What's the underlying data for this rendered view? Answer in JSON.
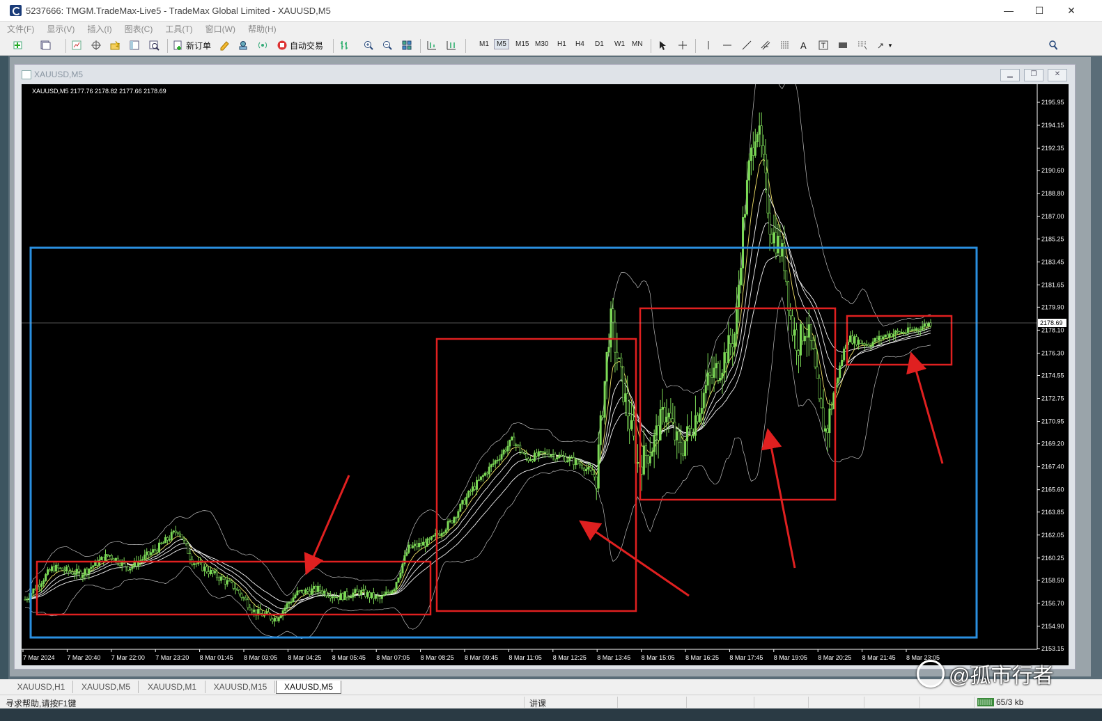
{
  "window": {
    "title": "5237666: TMGM.TradeMax-Live5 - TradeMax Global Limited - XAUUSD,M5",
    "minimize": "—",
    "maximize": "☐",
    "close": "✕"
  },
  "menu": [
    "文件(F)",
    "显示(V)",
    "插入(I)",
    "图表(C)",
    "工具(T)",
    "窗口(W)",
    "帮助(H)"
  ],
  "toolbar": {
    "new_order": "新订单",
    "auto_trading": "自动交易",
    "timeframes": [
      "M1",
      "M5",
      "M15",
      "M30",
      "H1",
      "H4",
      "D1",
      "W1",
      "MN"
    ],
    "active_timeframe": "M5",
    "text_tool": "A",
    "notification_count": "1"
  },
  "chart_window": {
    "title": "XAUUSD,M5"
  },
  "chart_data": {
    "type": "candlestick",
    "header": "XAUUSD,M5  2177.76 2178.82 2177.66 2178.69",
    "symbol": "XAUUSD,M5",
    "ohlc": {
      "open": 2177.76,
      "high": 2178.82,
      "low": 2177.66,
      "close": 2178.69
    },
    "current_price": "2178.69",
    "ylim": [
      2153.15,
      2197.6
    ],
    "y_ticks": [
      "2195.95",
      "2194.15",
      "2192.35",
      "2190.60",
      "2188.80",
      "2187.00",
      "2185.25",
      "2183.45",
      "2181.65",
      "2179.90",
      "2178.10",
      "2176.30",
      "2174.55",
      "2172.75",
      "2170.95",
      "2169.20",
      "2167.40",
      "2165.60",
      "2163.85",
      "2162.05",
      "2160.25",
      "2158.50",
      "2156.70",
      "2154.90",
      "2153.15"
    ],
    "x_ticks": [
      "7 Mar 2024",
      "7 Mar 20:40",
      "7 Mar 22:00",
      "7 Mar 23:20",
      "8 Mar 01:45",
      "8 Mar 03:05",
      "8 Mar 04:25",
      "8 Mar 05:45",
      "8 Mar 07:05",
      "8 Mar 08:25",
      "8 Mar 09:45",
      "8 Mar 11:05",
      "8 Mar 12:25",
      "8 Mar 13:45",
      "8 Mar 15:05",
      "8 Mar 16:25",
      "8 Mar 17:45",
      "8 Mar 19:05",
      "8 Mar 20:25",
      "8 Mar 21:45",
      "8 Mar 23:05"
    ],
    "series": [
      {
        "values": [
          [
            0,
            2157.0
          ],
          [
            4,
            2159.5
          ],
          [
            8,
            2159.0
          ],
          [
            12,
            2160.5
          ],
          [
            15,
            2159.5
          ],
          [
            19,
            2161.0
          ],
          [
            22,
            2162.5
          ],
          [
            24,
            2160.0
          ],
          [
            27,
            2159.0
          ],
          [
            30,
            2158.0
          ],
          [
            33,
            2156.0
          ],
          [
            36,
            2155.5
          ],
          [
            39,
            2157.5
          ],
          [
            42,
            2157.8
          ],
          [
            45,
            2157.2
          ],
          [
            48,
            2157.6
          ],
          [
            51,
            2157.0
          ],
          [
            53,
            2158.0
          ],
          [
            55,
            2161.0
          ],
          [
            58,
            2161.5
          ],
          [
            61,
            2163.0
          ],
          [
            64,
            2165.5
          ],
          [
            67,
            2167.5
          ],
          [
            70,
            2169.5
          ],
          [
            72,
            2168.0
          ],
          [
            75,
            2168.5
          ],
          [
            78,
            2168.0
          ],
          [
            80,
            2167.5
          ],
          [
            82,
            2166.5
          ],
          [
            84,
            2179.0
          ],
          [
            86,
            2173.0
          ],
          [
            88,
            2167.5
          ],
          [
            90,
            2169.0
          ],
          [
            92,
            2172.0
          ],
          [
            94,
            2168.5
          ],
          [
            96,
            2171.0
          ],
          [
            98,
            2174.0
          ],
          [
            100,
            2175.5
          ],
          [
            102,
            2178.0
          ],
          [
            103,
            2186.0
          ],
          [
            104,
            2191.0
          ],
          [
            105,
            2194.5
          ],
          [
            106,
            2191.0
          ],
          [
            107,
            2186.0
          ],
          [
            108,
            2185.0
          ],
          [
            109,
            2183.5
          ],
          [
            110,
            2178.5
          ],
          [
            111,
            2177.0
          ],
          [
            112,
            2178.5
          ],
          [
            113,
            2176.5
          ],
          [
            114,
            2172.0
          ],
          [
            115,
            2170.0
          ],
          [
            116,
            2173.0
          ],
          [
            118,
            2177.5
          ],
          [
            121,
            2177.0
          ],
          [
            124,
            2177.8
          ],
          [
            127,
            2178.0
          ],
          [
            130,
            2178.69
          ]
        ]
      }
    ],
    "annotation_boxes": [
      {
        "color": "#e02020",
        "label": ""
      },
      {
        "color": "#e02020",
        "label": ""
      },
      {
        "color": "#e02020",
        "label": ""
      },
      {
        "color": "#e02020",
        "label": ""
      },
      {
        "color": "#2a8fe0",
        "label": ""
      }
    ]
  },
  "tabs": [
    {
      "label": "XAUUSD,H1",
      "active": false
    },
    {
      "label": "XAUUSD,M5",
      "active": false
    },
    {
      "label": "XAUUSD,M1",
      "active": false
    },
    {
      "label": "XAUUSD,M15",
      "active": false
    },
    {
      "label": "XAUUSD,M5",
      "active": true
    }
  ],
  "status": {
    "help": "寻求帮助,请按F1键",
    "profile": "讲课",
    "traffic": "65/3 kb"
  },
  "watermark": {
    "text": "@孤市行者"
  },
  "colors": {
    "candle": "#7cd957",
    "band": "#bdbdbd",
    "ma": "#f4f4f4",
    "box_red": "#e02020",
    "box_blue": "#2a8fe0",
    "bg": "#000000"
  }
}
